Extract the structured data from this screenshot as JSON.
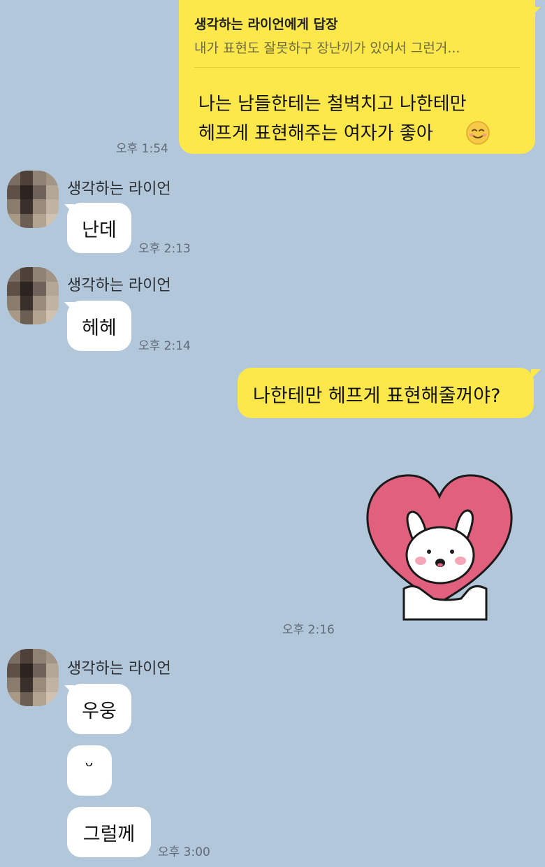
{
  "messages": {
    "reply_bubble": {
      "reply_to": "생각하는 라이언에게 답장",
      "quoted": "내가 표현도 잘못하구 장난끼가 있어서 그런거...",
      "line1": "나는 남들한테는 철벽치고 나한테만",
      "line2": "헤프게 표현해주는 여자가 좋아",
      "emoji": "smiling-face-emoji",
      "time": "오후 1:54"
    },
    "in1": {
      "sender": "생각하는 라이언",
      "text": "난데",
      "time": "오후 2:13"
    },
    "in2": {
      "sender": "생각하는 라이언",
      "text": "헤헤",
      "time": "오후 2:14"
    },
    "out2": {
      "text": "나한테만 헤프게 표현해줄꺼야?"
    },
    "sticker": {
      "icon": "heart-bunny-sticker",
      "time": "오후 2:16"
    },
    "in3": {
      "sender": "생각하는 라이언",
      "lines": [
        "우웅",
        "ᵕ",
        "그럴께"
      ],
      "time": "오후 3:00"
    }
  },
  "colors": {
    "background": "#b2c7da",
    "outgoing_bubble": "#fce84a",
    "incoming_bubble": "#ffffff",
    "heart": "#e0607e"
  }
}
